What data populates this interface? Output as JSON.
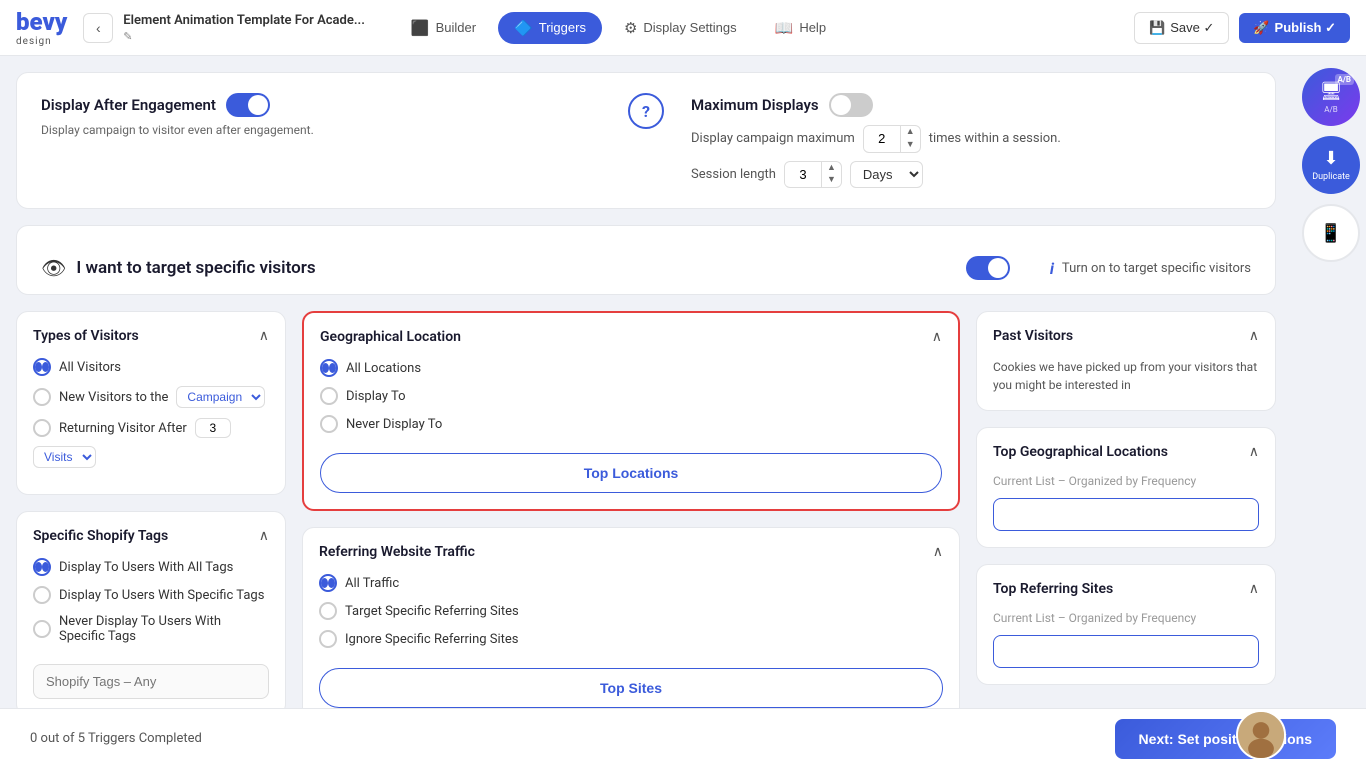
{
  "brand": {
    "name_part1": "bevy",
    "name_part2": "",
    "tagline": "design"
  },
  "nav": {
    "back_label": "‹",
    "title": "Element Animation Template For Acade...",
    "edit_icon": "✎",
    "tabs": [
      {
        "id": "builder",
        "label": "Builder",
        "icon": "⬛"
      },
      {
        "id": "triggers",
        "label": "Triggers",
        "icon": "🔷",
        "active": true
      },
      {
        "id": "display-settings",
        "label": "Display Settings",
        "icon": "⚙"
      },
      {
        "id": "help",
        "label": "Help",
        "icon": "📖"
      }
    ],
    "save_label": "Save ✓",
    "publish_label": "Publish ✓"
  },
  "right_sidebar": {
    "ab_test_label": "A/B",
    "duplicate_label": "Duplicate",
    "mobile_label": ""
  },
  "engagement_section": {
    "title": "Display After Engagement",
    "subtitle": "Display campaign to visitor even after engagement.",
    "toggle_on": true
  },
  "max_displays": {
    "title": "Maximum Displays",
    "toggle_on": false,
    "times_label": "Display campaign maximum",
    "times_value": "2",
    "times_suffix": "times within a session.",
    "session_label": "Session length",
    "session_value": "3",
    "session_unit": "Days"
  },
  "target_visitors": {
    "title": "I want to target specific visitors",
    "toggle_on": true,
    "info_text": "Turn on to target specific visitors"
  },
  "types_of_visitors": {
    "title": "Types of Visitors",
    "options": [
      {
        "label": "All Visitors",
        "checked": true
      },
      {
        "label": "New Visitors to the",
        "checked": false,
        "has_select": true,
        "select_val": "Campaign"
      },
      {
        "label": "Returning Visitor After",
        "checked": false,
        "has_num": true,
        "num_val": "3",
        "has_select2": true,
        "select2_val": "Visits"
      }
    ]
  },
  "shopify_tags": {
    "title": "Specific Shopify Tags",
    "options": [
      {
        "label": "Display To Users With All Tags",
        "checked": true
      },
      {
        "label": "Display To Users With Specific Tags",
        "checked": false
      },
      {
        "label": "Never Display To Users With Specific Tags",
        "checked": false
      }
    ],
    "input_placeholder": "Shopify Tags – Any"
  },
  "geo_location": {
    "title": "Geographical Location",
    "highlighted": true,
    "options": [
      {
        "label": "All Locations",
        "checked": true
      },
      {
        "label": "Display To",
        "checked": false
      },
      {
        "label": "Never Display To",
        "checked": false
      }
    ],
    "top_btn_label": "Top Locations"
  },
  "referring_traffic": {
    "title": "Referring Website Traffic",
    "options": [
      {
        "label": "All Traffic",
        "checked": true
      },
      {
        "label": "Target Specific Referring Sites",
        "checked": false
      },
      {
        "label": "Ignore Specific Referring Sites",
        "checked": false
      }
    ],
    "top_btn_label": "Top Sites"
  },
  "past_visitors": {
    "title": "Past Visitors",
    "description": "Cookies we have picked up from your visitors that you might be interested in"
  },
  "top_geo": {
    "title": "Top Geographical Locations",
    "current_list_label": "Current List",
    "organized_label": "– Organized by Frequency",
    "input_placeholder": ""
  },
  "top_referring": {
    "title": "Top Referring Sites",
    "current_list_label": "Current List",
    "organized_label": "– Organized by Frequency"
  },
  "bottom_bar": {
    "progress_text": "0 out of 5 Triggers Completed",
    "next_btn_label": "Next: Set position options"
  }
}
